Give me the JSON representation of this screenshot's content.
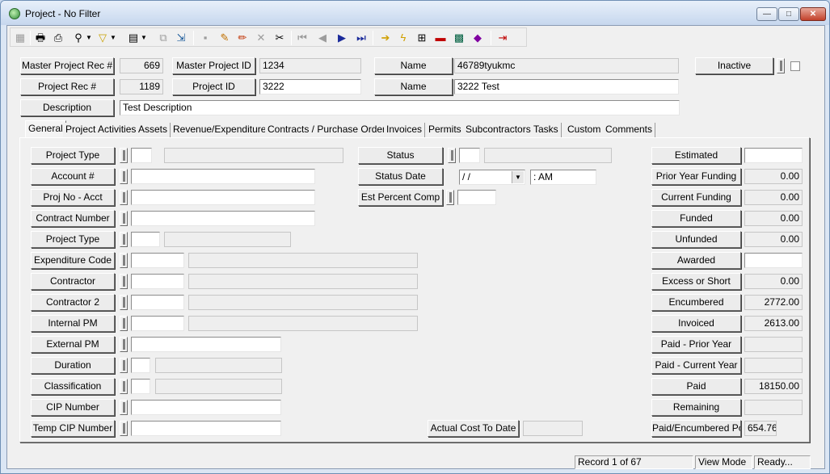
{
  "window": {
    "title": "Project - No Filter",
    "minimize": "—",
    "maximize": "□",
    "close": "✕"
  },
  "toolbar": {
    "icons": [
      "grid-icon",
      "print-icon",
      "print-preview-icon",
      "binoculars-icon",
      "filter-icon",
      "report-icon",
      "copy-icon",
      "export-icon",
      "save-icon",
      "attach-icon",
      "edit-icon",
      "delete-icon",
      "cut-icon",
      "first-record-icon",
      "previous-record-icon",
      "next-record-icon",
      "last-record-icon",
      "arrow-icon",
      "lightning-icon",
      "hierarchy-icon",
      "vehicle-icon",
      "calculator-icon",
      "book-icon",
      "exit-icon"
    ]
  },
  "header": {
    "master_project_rec_label": "Master Project Rec #",
    "master_project_rec_value": "669",
    "master_project_id_label": "Master Project ID",
    "master_project_id_value": "1234",
    "name1_label": "Name",
    "name1_value": "46789tyukmc",
    "inactive_label": "Inactive",
    "project_rec_label": "Project Rec #",
    "project_rec_value": "1189",
    "project_id_label": "Project ID",
    "project_id_value": "3222",
    "name2_label": "Name",
    "name2_value": "3222 Test",
    "description_label": "Description",
    "description_value": "Test Description"
  },
  "tabs": [
    "General",
    "Project Activities",
    "Assets",
    "Revenue/Expenditure",
    "Contracts / Purchase Orders",
    "Invoices",
    "Permits",
    "Subcontractors",
    "Tasks",
    "Custom",
    "Comments"
  ],
  "general": {
    "left": [
      {
        "label": "Project Type",
        "value": "",
        "desc": ""
      },
      {
        "label": "Account #",
        "value": ""
      },
      {
        "label": "Proj No - Acct",
        "value": ""
      },
      {
        "label": "Contract Number",
        "value": ""
      },
      {
        "label": "Project Type",
        "value": "",
        "desc": ""
      },
      {
        "label": "Expenditure Code",
        "value": "",
        "desc": ""
      },
      {
        "label": "Contractor",
        "value": "",
        "desc": ""
      },
      {
        "label": "Contractor 2",
        "value": "",
        "desc": ""
      },
      {
        "label": "Internal PM",
        "value": "",
        "desc": ""
      },
      {
        "label": "External PM",
        "value": ""
      },
      {
        "label": "Duration",
        "value": "",
        "desc": ""
      },
      {
        "label": "Classification",
        "value": "",
        "desc": ""
      },
      {
        "label": "CIP Number",
        "value": ""
      },
      {
        "label": "Temp CIP Number",
        "value": ""
      }
    ],
    "middle": {
      "status_label": "Status",
      "status_value": "",
      "status_desc": "",
      "status_date_label": "Status Date",
      "status_date_value": " / /",
      "status_time_value": " :  AM",
      "est_percent_label": "Est Percent Comp",
      "est_percent_value": "",
      "actual_cost_label": "Actual Cost To Date",
      "actual_cost_value": ""
    },
    "right": [
      {
        "label": "Estimated",
        "value": ""
      },
      {
        "label": "Prior Year Funding",
        "value": "0.00"
      },
      {
        "label": "Current Funding",
        "value": "0.00"
      },
      {
        "label": "Funded",
        "value": "0.00"
      },
      {
        "label": "Unfunded",
        "value": "0.00"
      },
      {
        "label": "Awarded",
        "value": ""
      },
      {
        "label": "Excess or Short",
        "value": "0.00"
      },
      {
        "label": "Encumbered",
        "value": "2772.00"
      },
      {
        "label": "Invoiced",
        "value": "2613.00"
      },
      {
        "label": "Paid - Prior Year",
        "value": ""
      },
      {
        "label": "Paid - Current Year",
        "value": ""
      },
      {
        "label": "Paid",
        "value": "18150.00"
      },
      {
        "label": "Remaining",
        "value": ""
      },
      {
        "label": "Paid/Encumbered Pct",
        "value": "654.76"
      }
    ]
  },
  "statusbar": {
    "record": "Record 1 of 67",
    "mode": "View Mode",
    "state": "Ready..."
  }
}
